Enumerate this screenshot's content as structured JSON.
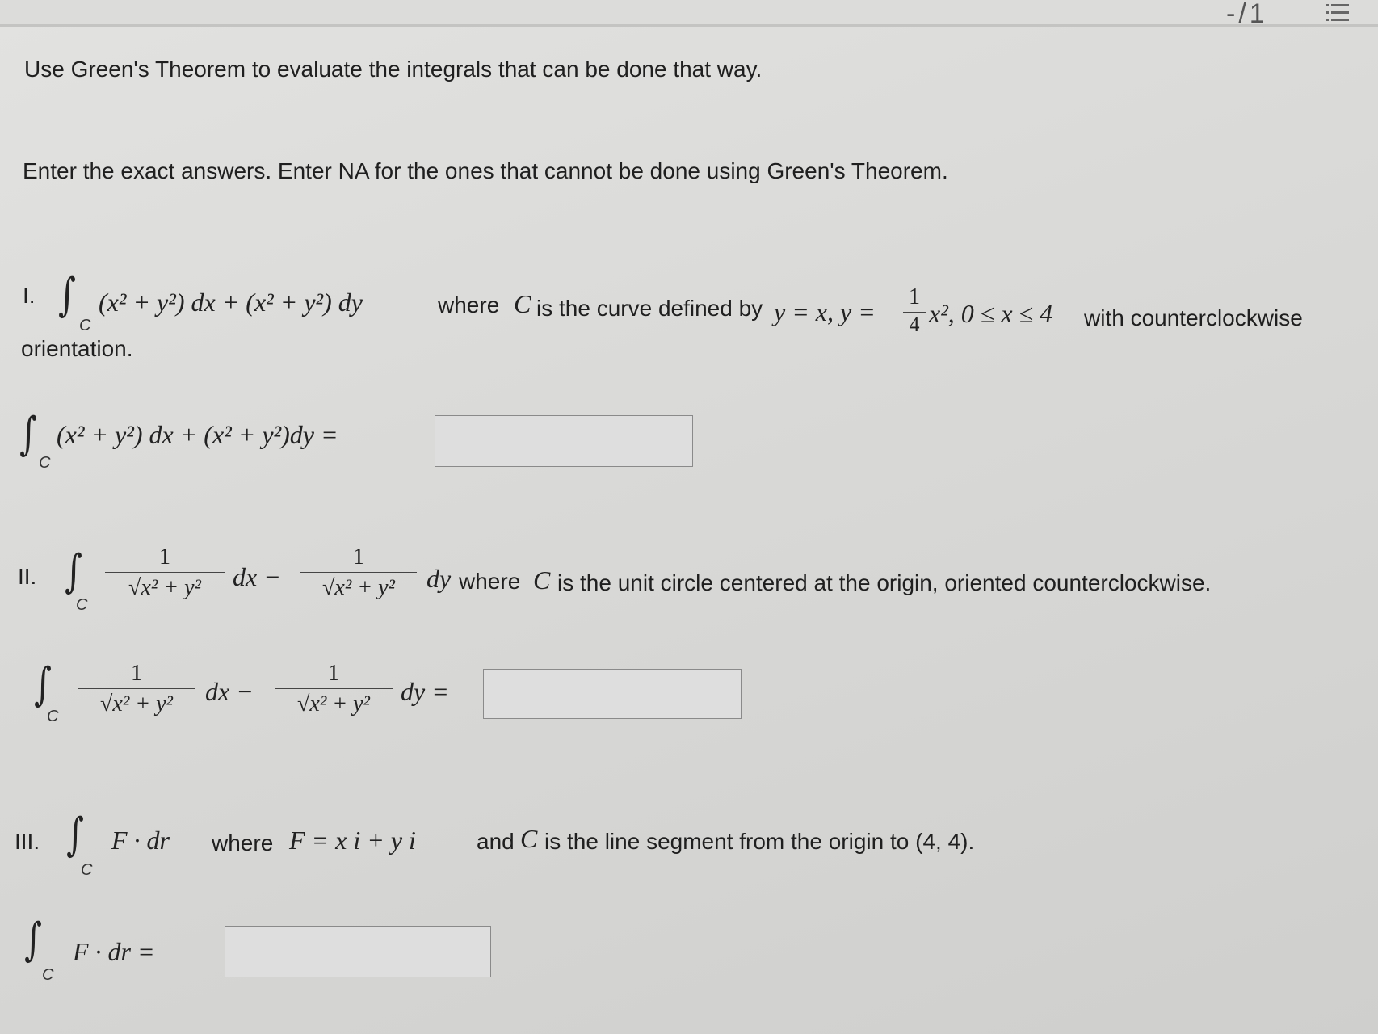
{
  "toolbar": {
    "page_counter": "-/1"
  },
  "instructions": {
    "line1": "Use Green's Theorem to evaluate the integrals that can be done that way.",
    "line2": "Enter the exact answers. Enter NA for the ones that cannot be done using Green's Theorem."
  },
  "problems": [
    {
      "number": "I.",
      "integrand": "(x² + y²) dx + (x² + y²) dy",
      "where_text": "where",
      "curve_text": "is the curve defined by",
      "curve_eq": "y = x, y =",
      "frac_num": "1",
      "frac_den": "4",
      "curve_tail": "x², 0 ≤ x ≤ 4",
      "orientation_text": "with counterclockwise",
      "orientation_cont": "orientation.",
      "answer_lhs": "(x² + y²) dx + (x² + y²)dy =",
      "answer_value": ""
    },
    {
      "number": "II.",
      "frac_num": "1",
      "frac_den": "√x² + y²",
      "mid": "dx −",
      "tail": "dy",
      "where_text": "where",
      "desc": "is the unit circle centered at the origin, oriented counterclockwise.",
      "answer_eq": "dy =",
      "answer_value": ""
    },
    {
      "number": "III.",
      "expr": "F · dr",
      "where_text": "where",
      "field": "F = x i + y i",
      "desc_and": "and",
      "desc": "is the line segment from the origin to (4, 4).",
      "answer_lhs": "F · dr =",
      "answer_value": ""
    }
  ],
  "symbols": {
    "integral": "∫",
    "curve": "C"
  }
}
